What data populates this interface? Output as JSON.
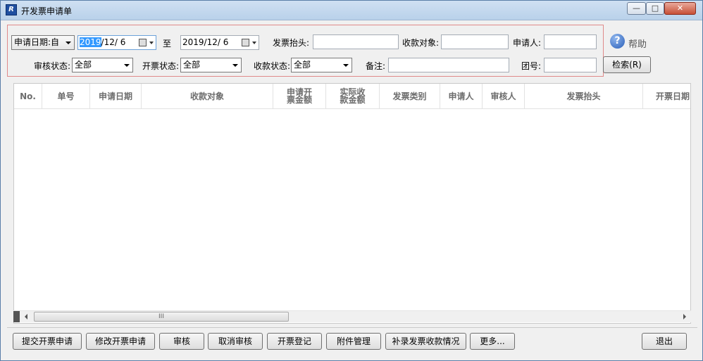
{
  "window": {
    "title": "开发票申请单"
  },
  "filters": {
    "date_type": "申请日期:自",
    "date_from": {
      "highlight": "2019",
      "rest": "/12/  6"
    },
    "to_label": "至",
    "date_to": "2019/12/  6",
    "invoice_title_label": "发票抬头:",
    "invoice_title_value": "",
    "payee_label": "收款对象:",
    "payee_value": "",
    "applicant_label": "申请人:",
    "applicant_value": "",
    "audit_status_label": "审核状态:",
    "audit_status_value": "全部",
    "invoice_status_label": "开票状态:",
    "invoice_status_value": "全部",
    "collection_status_label": "收款状态:",
    "collection_status_value": "全部",
    "remark_label": "备注:",
    "remark_value": "",
    "group_no_label": "团号:",
    "group_no_value": ""
  },
  "help": {
    "label": "帮助",
    "icon": "help-icon"
  },
  "search_button": "检索(R)",
  "table": {
    "columns": [
      "No.",
      "单号",
      "申请日期",
      "收款对象",
      "申请开票金额",
      "实际收款金额",
      "发票类别",
      "申请人",
      "审核人",
      "发票抬头",
      "开票日期"
    ],
    "rows": []
  },
  "scrollbar": {
    "thumb_grip": "III"
  },
  "toolbar": {
    "submit": "提交开票申请",
    "modify": "修改开票申请",
    "audit": "审核",
    "cancel_audit": "取消审核",
    "register": "开票登记",
    "attachments": "附件管理",
    "supplement": "补录发票收款情况",
    "more": "更多...",
    "exit": "退出"
  }
}
